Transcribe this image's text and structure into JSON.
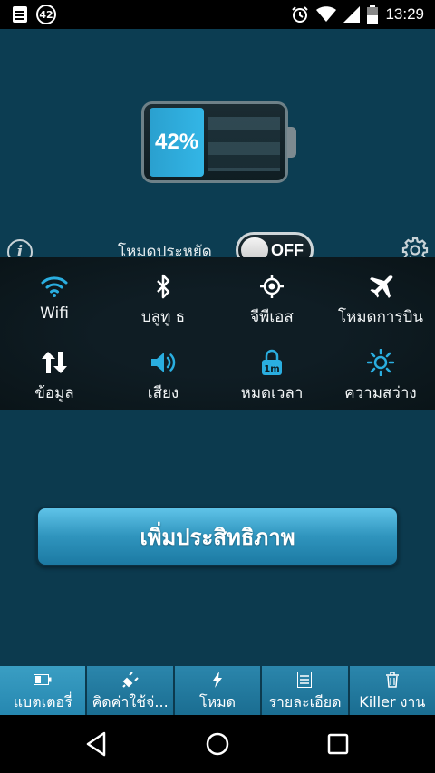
{
  "status_bar": {
    "notification_count": "42",
    "time": "13:29"
  },
  "battery": {
    "level_text": "42%",
    "level": 42
  },
  "power_save": {
    "label": "โหมดประหยัด",
    "toggle_state": "OFF"
  },
  "quick_settings": [
    {
      "label": "Wifi",
      "icon": "wifi-icon"
    },
    {
      "label": "บลูทู ธ",
      "icon": "bluetooth-icon"
    },
    {
      "label": "จีพีเอส",
      "icon": "gps-icon"
    },
    {
      "label": "โหมดการบิน",
      "icon": "airplane-icon"
    },
    {
      "label": "ข้อมูล",
      "icon": "data-icon"
    },
    {
      "label": "เสียง",
      "icon": "sound-icon"
    },
    {
      "label": "หมดเวลา",
      "icon": "timeout-lock-icon"
    },
    {
      "label": "ความสว่าง",
      "icon": "brightness-icon"
    }
  ],
  "timeout_badge": "1m",
  "boost_button": "เพิ่มประสิทธิภาพ",
  "tabs": [
    {
      "label": "แบตเตอรี่",
      "icon": "battery-icon",
      "active": true
    },
    {
      "label": "คิดค่าใช้จ่...",
      "icon": "plug-icon",
      "active": false
    },
    {
      "label": "โหมด",
      "icon": "bolt-icon",
      "active": false
    },
    {
      "label": "รายละเอียด",
      "icon": "list-icon",
      "active": false
    },
    {
      "label": "Killer งาน",
      "icon": "trash-icon",
      "active": false
    }
  ],
  "colors": {
    "background": "#0c3a4e",
    "accent": "#33b6e6",
    "tab_bar": "#1a6d91"
  }
}
